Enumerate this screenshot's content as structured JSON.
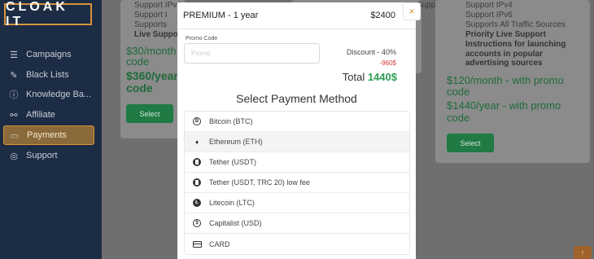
{
  "app": {
    "logo": "CLOAK IT"
  },
  "sidebar": {
    "items": [
      {
        "label": "Campaigns",
        "icon": "list-icon"
      },
      {
        "label": "Black Lists",
        "icon": "edit-icon"
      },
      {
        "label": "Knowledge Ba...",
        "icon": "info-icon"
      },
      {
        "label": "Affiliate",
        "icon": "handshake-icon"
      },
      {
        "label": "Payments",
        "icon": "credit-card-icon",
        "active": true
      },
      {
        "label": "Support",
        "icon": "lifebuoy-icon"
      }
    ]
  },
  "background": {
    "left_plan": {
      "features": [
        "Support IPv4",
        "Support I",
        "Supports",
        "Live Suppo"
      ],
      "monthly": "$30/month",
      "monthly_suffix": "code",
      "yearly": "$360/year",
      "yearly_suffix": "code",
      "button": "Select"
    },
    "mid_plan": {
      "features": [
        "Support IPv4"
      ]
    },
    "right_plan": {
      "features": [
        "Support IPv4",
        "Support IPv6",
        "Supports All Traffic Sources",
        "Priority Live Support",
        "Instructions for launching",
        "accounts in popular",
        "advertising sources"
      ],
      "monthly": "$120/month - with promo",
      "monthly_suffix": "code",
      "yearly": "$1440/year - with promo",
      "yearly_suffix": "code",
      "button": "Select"
    }
  },
  "modal": {
    "title": "PREMIUM - 1 year",
    "amount": "$2400",
    "close": "×",
    "promo_label": "Promo Code",
    "promo_value": "Promo",
    "discount": "Discount - 40%",
    "discount_amount": "-960$",
    "total_label": "Total",
    "total_value": "1440$",
    "payment_title": "Select Payment Method",
    "methods": [
      {
        "label": "Bitcoin (BTC)",
        "icon": "bitcoin-icon"
      },
      {
        "label": "Ethereum (ETH)",
        "icon": "ethereum-icon"
      },
      {
        "label": "Tether (USDT)",
        "icon": "tether-icon"
      },
      {
        "label": "Tether (USDT, TRC 20) low fee",
        "icon": "tether-icon"
      },
      {
        "label": "Litecoin (LTC)",
        "icon": "litecoin-icon"
      },
      {
        "label": "Capitalist (USD)",
        "icon": "capitalist-icon"
      },
      {
        "label": "CARD",
        "icon": "card-icon"
      }
    ]
  },
  "scroll_top": "↑"
}
